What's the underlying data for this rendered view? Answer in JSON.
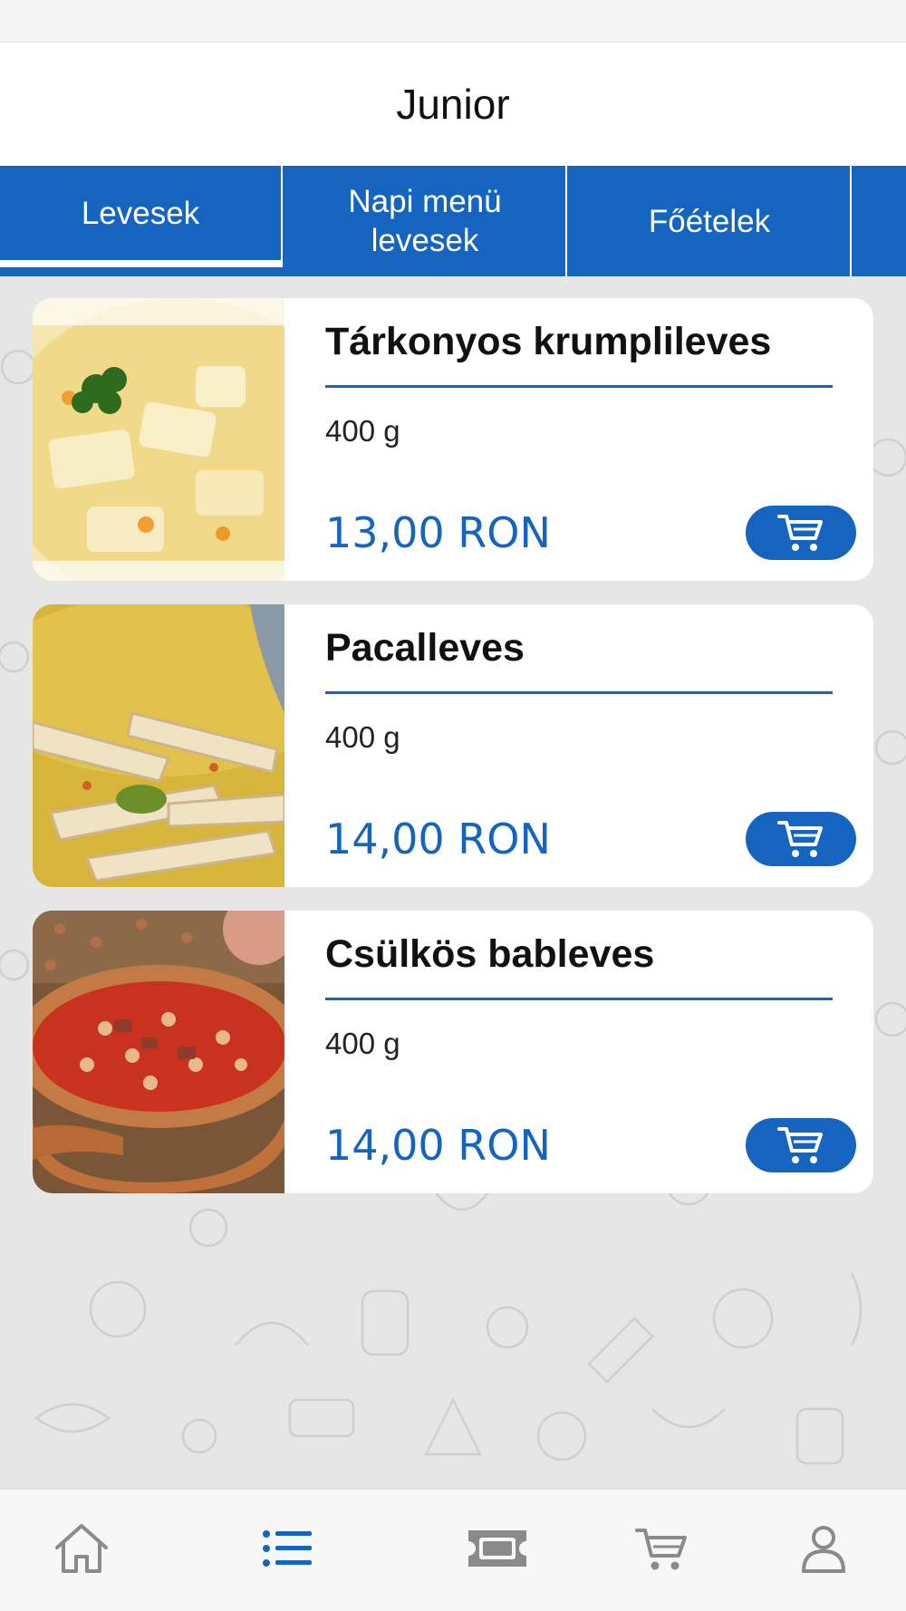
{
  "header": {
    "title": "Junior"
  },
  "tabs": [
    {
      "label": "Levesek",
      "active": true
    },
    {
      "label": "Napi menü\nlevesek",
      "active": false
    },
    {
      "label": "Főételek",
      "active": false
    }
  ],
  "products": [
    {
      "name": "Tárkonyos krumplileves",
      "weight": "400 g",
      "price": "13,00 RON",
      "image": "potato-soup-photo"
    },
    {
      "name": "Pacalleves",
      "weight": "400 g",
      "price": "14,00 RON",
      "image": "tripe-soup-photo"
    },
    {
      "name": "Csülkös bableves",
      "weight": "400 g",
      "price": "14,00 RON",
      "image": "bean-soup-photo"
    }
  ],
  "bottom_nav": [
    {
      "icon": "home-icon",
      "active": false
    },
    {
      "icon": "list-icon",
      "active": true
    },
    {
      "icon": "ticket-icon",
      "active": false
    },
    {
      "icon": "cart-icon",
      "active": false
    },
    {
      "icon": "user-icon",
      "active": false
    }
  ],
  "colors": {
    "accent": "#1565c0",
    "background": "#e6e6e6",
    "nav_inactive": "#8a8a8a"
  }
}
